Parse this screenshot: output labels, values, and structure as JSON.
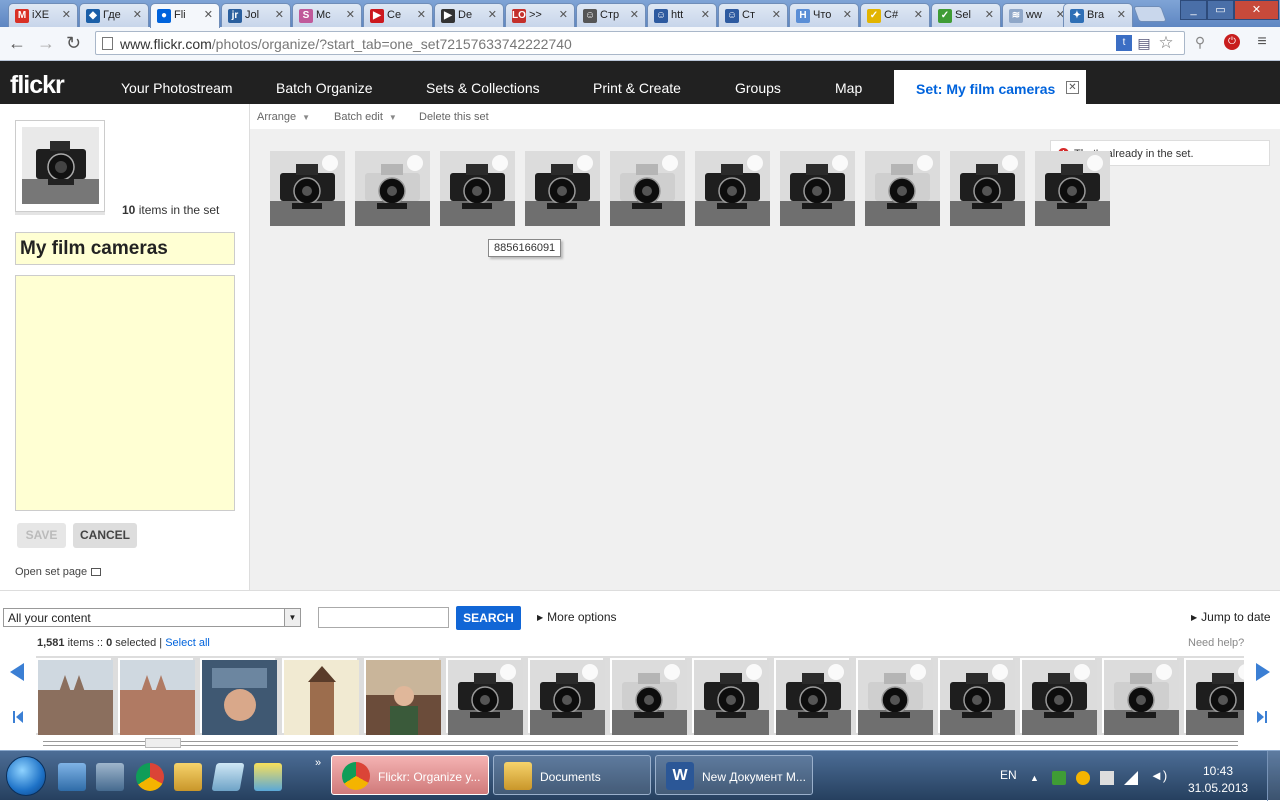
{
  "browser": {
    "tabs": [
      {
        "label": "iXE",
        "icon": "gmail-icon",
        "color": "#d93025",
        "glyph": "M"
      },
      {
        "label": "Где",
        "icon": "globe-icon",
        "color": "#1b5fa8",
        "glyph": "◆"
      },
      {
        "label": "Fli",
        "icon": "flickr-icon",
        "color": "#0063dc",
        "glyph": "●",
        "active": true
      },
      {
        "label": "Jol",
        "icon": "jr-icon",
        "color": "#2a5f9e",
        "glyph": "jr"
      },
      {
        "label": "Mc",
        "icon": "s-logo-icon",
        "color": "#c05a9a",
        "glyph": "S"
      },
      {
        "label": "Ce",
        "icon": "youtube-icon",
        "color": "#cc181e",
        "glyph": "▶"
      },
      {
        "label": "De",
        "icon": "play-circle-icon",
        "color": "#333333",
        "glyph": "▶"
      },
      {
        "label": ">>",
        "icon": "lo-icon",
        "color": "#c4302b",
        "glyph": "LO"
      },
      {
        "label": "Стр",
        "icon": "user-icon",
        "color": "#555555",
        "glyph": "☺"
      },
      {
        "label": "htt",
        "icon": "user-icon",
        "color": "#2d5aa0",
        "glyph": "☺"
      },
      {
        "label": "Ст",
        "icon": "user-icon",
        "color": "#2d5aa0",
        "glyph": "☺"
      },
      {
        "label": "Что",
        "icon": "h-icon",
        "color": "#5a8ed6",
        "glyph": "H"
      },
      {
        "label": "C#",
        "icon": "checkmark-icon",
        "color": "#e2b400",
        "glyph": "✓"
      },
      {
        "label": "Sel",
        "icon": "checkmark-icon",
        "color": "#3f9c35",
        "glyph": "✓"
      },
      {
        "label": "ww",
        "icon": "wolfram-icon",
        "color": "#8fa7c8",
        "glyph": "≋"
      },
      {
        "label": "Bra",
        "icon": "bracket-icon",
        "color": "#2e6fb6",
        "glyph": "✦"
      }
    ],
    "url_main": "www.flickr.com",
    "url_rest": "/photos/organize/?start_tab=one_set72157633742222740",
    "window_controls": {
      "minimize": "_",
      "maximize": "▭",
      "close": "✕"
    }
  },
  "flickr": {
    "logo": "flickr",
    "nav": [
      "Your Photostream",
      "Batch Organize",
      "Sets & Collections",
      "Print & Create",
      "Groups",
      "Map"
    ],
    "active_tab": "Set: My film cameras",
    "active_tab_close": "✕"
  },
  "set_panel": {
    "item_count": "10",
    "item_count_suffix": " items in the set",
    "title": "My film cameras",
    "description": "",
    "save_label": "SAVE",
    "cancel_label": "CANCEL",
    "open_set_label": "Open set page"
  },
  "subtoolbar": {
    "arrange": "Arrange",
    "batch_edit": "Batch edit",
    "delete": "Delete this set"
  },
  "workspace": {
    "photos_count": 10,
    "tooltip": "8856166091",
    "notice": "That's already in the set."
  },
  "search": {
    "scope": "All your content",
    "query": "",
    "button": "SEARCH",
    "more_options": "More options",
    "jump_to_date": "Jump to date",
    "items_count": "1,581",
    "items_word": " items :: ",
    "selected_count": "0",
    "selected_word": " selected | ",
    "select_all": "Select all",
    "need_help": "Need help?"
  },
  "photostream": {
    "thumbs": [
      {
        "kind": "cathedral",
        "color": "#8b6f5e"
      },
      {
        "kind": "cathedral",
        "color": "#b07a63"
      },
      {
        "kind": "statue",
        "color": "#3f5872"
      },
      {
        "kind": "tower",
        "color": "#d8c79a"
      },
      {
        "kind": "person",
        "color": "#6b4c3a"
      },
      {
        "kind": "camera",
        "color": "#555555"
      },
      {
        "kind": "camera",
        "color": "#555555"
      },
      {
        "kind": "camera",
        "color": "#555555"
      },
      {
        "kind": "camera",
        "color": "#555555"
      },
      {
        "kind": "camera",
        "color": "#555555"
      },
      {
        "kind": "camera",
        "color": "#555555"
      },
      {
        "kind": "camera",
        "color": "#555555"
      },
      {
        "kind": "camera",
        "color": "#555555"
      },
      {
        "kind": "camera",
        "color": "#555555"
      },
      {
        "kind": "camera",
        "color": "#555555"
      }
    ]
  },
  "taskbar": {
    "buttons": [
      {
        "label": "Flickr: Organize y...",
        "icon": "chrome-icon",
        "active": true
      },
      {
        "label": "Documents",
        "icon": "folder-icon",
        "active": false
      },
      {
        "label": "New Документ M...",
        "icon": "word-icon",
        "active": false
      }
    ],
    "lang": "EN",
    "time": "10:43",
    "date": "31.05.2013"
  },
  "colors": {
    "flickr_blue": "#0063dc",
    "nav_bg": "#212121",
    "field_yellow": "#ffffd3",
    "search_button": "#1166d6"
  }
}
